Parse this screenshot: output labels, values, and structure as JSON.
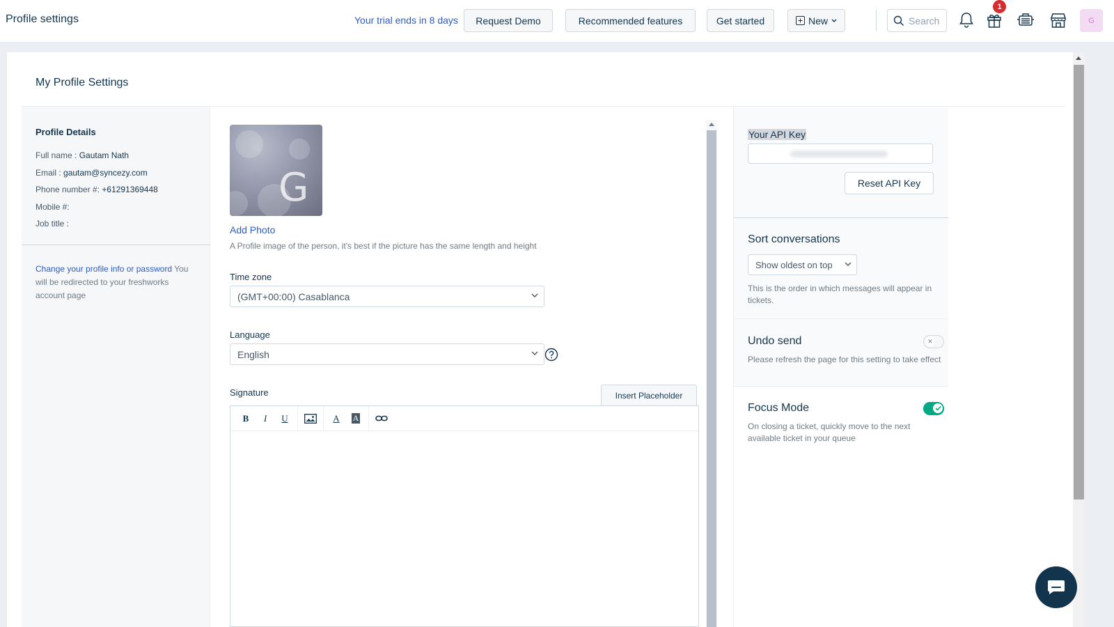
{
  "header": {
    "title": "Profile settings",
    "trial_text": "Your trial ends in 8 days",
    "request_demo": "Request Demo",
    "recommended": "Recommended features",
    "get_started": "Get started",
    "new_label": "New",
    "search_placeholder": "Search",
    "gift_badge": "1",
    "avatar_initial": "G"
  },
  "page": {
    "heading": "My Profile Settings"
  },
  "profile": {
    "section_title": "Profile Details",
    "full_name_label": "Full name : ",
    "full_name": "Gautam Nath",
    "email_label": "Email : ",
    "email": "gautam@syncezy.com",
    "phone_label": "Phone number #: ",
    "phone": "+61291369448",
    "mobile_label": "Mobile #:",
    "job_title_label": "Job title :",
    "change_link": "Change your profile info or password",
    "change_note": " You will be redirected to your freshworks account page"
  },
  "photo": {
    "initial": "G",
    "add_label": "Add Photo",
    "hint": "A Profile image of the person, it's best if the picture has the same length and height"
  },
  "timezone": {
    "label": "Time zone",
    "value": "(GMT+00:00) Casablanca"
  },
  "language": {
    "label": "Language",
    "value": "English"
  },
  "signature": {
    "label": "Signature",
    "insert_placeholder": "Insert Placeholder",
    "toolbar": {
      "bold": "B",
      "italic": "I",
      "underline": "U",
      "font_color": "A",
      "bg_color": "A"
    }
  },
  "api": {
    "label": "Your API Key",
    "reset_label": "Reset API Key"
  },
  "sort": {
    "title": "Sort conversations",
    "value": "Show oldest on top",
    "desc": "This is the order in which messages will appear in tickets."
  },
  "undo": {
    "title": "Undo send",
    "desc": "Please refresh the page for this setting to take effect",
    "enabled": false
  },
  "focus": {
    "title": "Focus Mode",
    "desc": "On closing a ticket, quickly move to the next available ticket in your queue",
    "enabled": true
  },
  "colors": {
    "accent": "#2c5cc5",
    "toggle_on": "#00a886",
    "badge": "#d72d30",
    "fab": "#12344d"
  }
}
